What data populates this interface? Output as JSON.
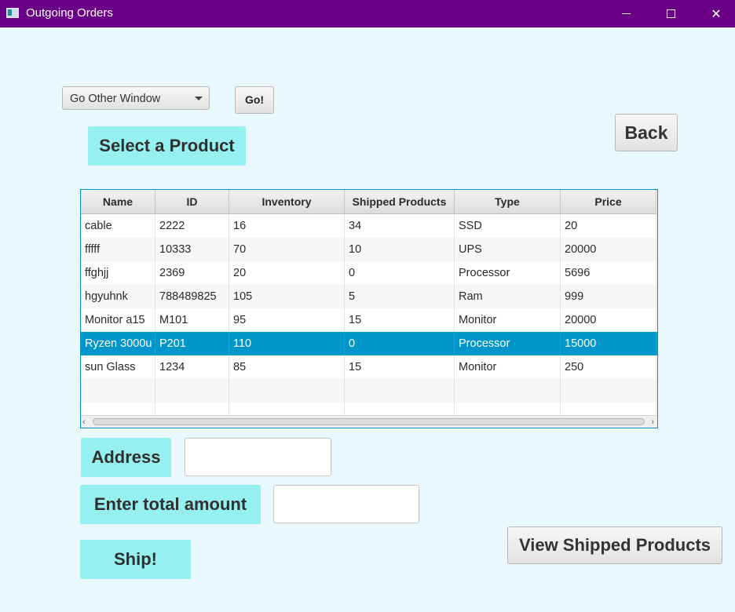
{
  "window": {
    "title": "Outgoing Orders",
    "icon": "app-window-icon",
    "controls": {
      "minimize_icon": "minimize-icon",
      "maximize_icon": "maximize-icon",
      "close_icon": "close-icon",
      "close_glyph": "✕"
    },
    "titlebar_color": "#6a0085"
  },
  "nav": {
    "combo_value": "Go Other Window",
    "go_label": "Go!",
    "back_label": "Back"
  },
  "labels": {
    "select_product": "Select a Product",
    "address": "Address",
    "total_amount": "Enter total amount",
    "ship": "Ship!"
  },
  "inputs": {
    "address_value": "",
    "amount_value": ""
  },
  "buttons": {
    "view_shipped": "View Shipped Products"
  },
  "table": {
    "columns": [
      "Name",
      "ID",
      "Inventory",
      "Shipped Products",
      "Type",
      "Price"
    ],
    "rows": [
      [
        "cable",
        "2222",
        "16",
        "34",
        "SSD",
        "20"
      ],
      [
        "fffff",
        "10333",
        "70",
        "10",
        "UPS",
        "20000"
      ],
      [
        "ffghjj",
        "2369",
        "20",
        "0",
        "Processor",
        "5696"
      ],
      [
        "hgyuhnk",
        "788489825",
        "105",
        "5",
        "Ram",
        "999"
      ],
      [
        "Monitor a15",
        "M101",
        "95",
        "15",
        "Monitor",
        "20000"
      ],
      [
        "Ryzen 3000u",
        "P201",
        "110",
        "0",
        "Processor",
        "15000"
      ],
      [
        "sun Glass",
        "1234",
        "85",
        "15",
        "Monitor",
        "250"
      ]
    ],
    "selected_row": 5,
    "selection_color": "#0096c9"
  },
  "colors": {
    "background": "#e8f8fd",
    "label_bg": "#96f0ef"
  }
}
